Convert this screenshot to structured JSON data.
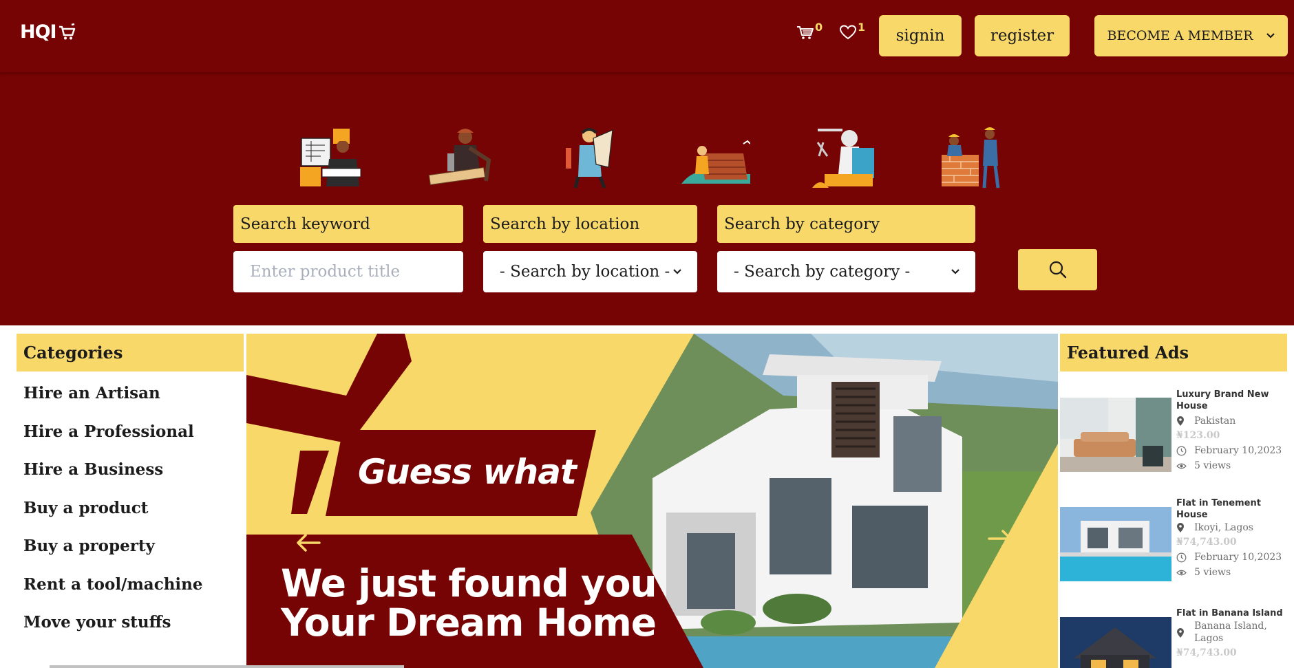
{
  "header": {
    "logo_text": "HQI",
    "cart_count": "0",
    "wishlist_count": "1",
    "signin_label": "signin",
    "register_label": "register",
    "member_label": "BECOME A MEMBER"
  },
  "search": {
    "keyword_label": "Search keyword",
    "location_label": "Search by location",
    "category_label": "Search by category",
    "keyword_placeholder": "Enter product title",
    "location_value": "- Search by location -",
    "category_value": "- Search by category -"
  },
  "categories": {
    "title": "Categories",
    "items": [
      "Hire an Artisan",
      "Hire a Professional",
      "Hire a Business",
      "Buy a product",
      "Buy a property",
      "Rent a tool/machine",
      "Move your stuffs"
    ]
  },
  "banner": {
    "headline": "Guess what",
    "line1": "We just found you",
    "line2": "Your Dream Home"
  },
  "featured": {
    "title": "Featured Ads",
    "ads": [
      {
        "title": "Luxury Brand New House",
        "location": "Pakistan",
        "price": "₦123.00",
        "date": "February 10,2023",
        "views": "5 views"
      },
      {
        "title": "Flat in Tenement House",
        "location": "Ikoyi, Lagos",
        "price": "₦74,743.00",
        "date": "February 10,2023",
        "views": "5 views"
      },
      {
        "title": "Flat in Banana Island",
        "location": "Banana Island, Lagos",
        "price": "₦74,743.00"
      }
    ]
  },
  "colors": {
    "maroon": "#760404",
    "yellow": "#f9d86a",
    "text_dark": "#1c1c1c"
  },
  "icons": [
    "cart-icon",
    "heart-icon",
    "chevron-down-icon",
    "search-icon",
    "arrow-left-icon",
    "arrow-right-icon",
    "location-pin-icon",
    "clock-icon",
    "eye-icon"
  ]
}
